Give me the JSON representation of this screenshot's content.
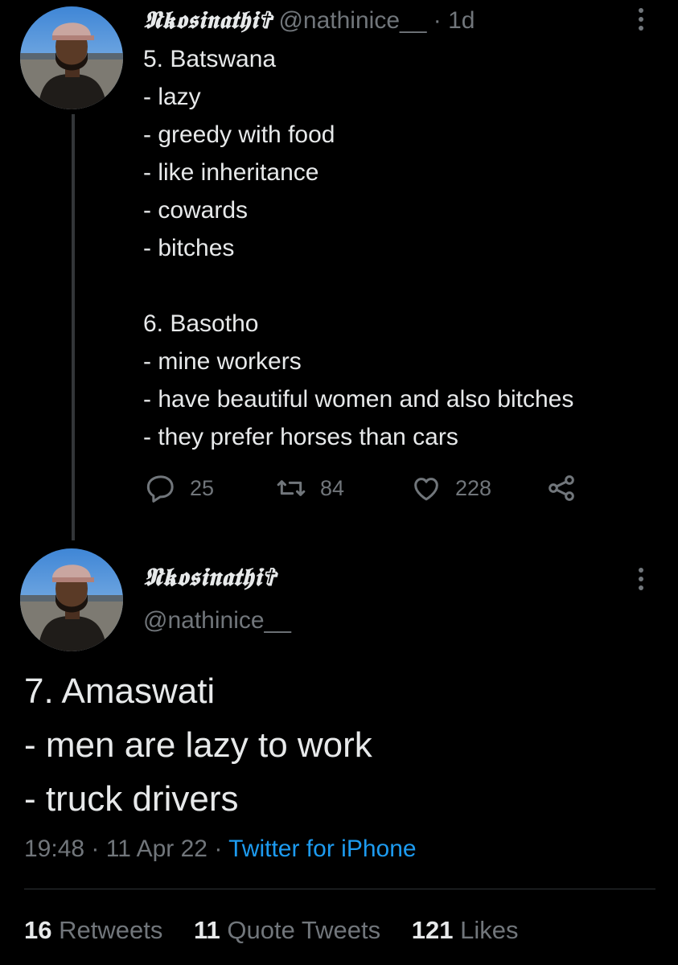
{
  "tweet1": {
    "display_name": "𝕹𝖐𝖔𝖘𝖎𝖓𝖆𝖙𝖍𝖎✞",
    "handle": "@nathinice__",
    "separator": "·",
    "timestamp": "1d",
    "lines": [
      "5. Batswana",
      "- lazy",
      "- greedy with food",
      "- like inheritance",
      "- cowards",
      "- bitches",
      "",
      "6. Basotho",
      "- mine workers",
      "- have beautiful women and also bitches",
      "- they prefer horses than cars"
    ],
    "actions": {
      "replies": "25",
      "retweets": "84",
      "likes": "228"
    }
  },
  "tweet2": {
    "display_name": "𝕹𝖐𝖔𝖘𝖎𝖓𝖆𝖙𝖍𝖎✞",
    "handle": "@nathinice__",
    "lines": [
      "7. Amaswati",
      "- men are lazy to work",
      "- truck drivers"
    ],
    "time": "19:48",
    "separator": "·",
    "date": "11 Apr 22",
    "source": "Twitter for iPhone",
    "stats": {
      "retweets_count": "16",
      "retweets_label": "Retweets",
      "quotes_count": "11",
      "quotes_label": "Quote Tweets",
      "likes_count": "121",
      "likes_label": "Likes"
    }
  },
  "colors": {
    "background": "#000000",
    "text": "#e7e9ea",
    "muted": "#71767b",
    "link": "#1d9bf0",
    "divider": "#2f3336",
    "thread_line": "#333639"
  },
  "icons": {
    "reply": "reply-icon",
    "retweet": "retweet-icon",
    "like": "heart-icon",
    "share": "share-icon",
    "more": "more-icon"
  }
}
